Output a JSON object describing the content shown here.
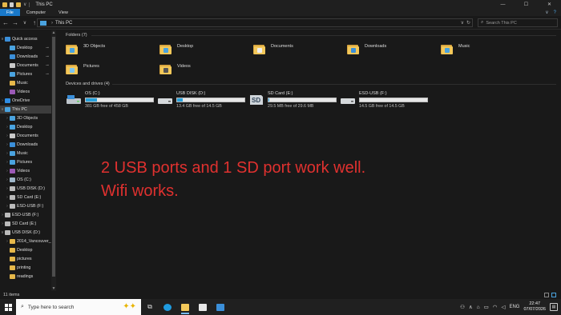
{
  "window": {
    "title": "This PC"
  },
  "ribbon": {
    "tabs": [
      {
        "label": "File",
        "active": true
      },
      {
        "label": "Computer"
      },
      {
        "label": "View"
      }
    ]
  },
  "address": {
    "crumbs": [
      "This PC"
    ]
  },
  "search": {
    "placeholder": "Search This PC"
  },
  "sidebar": {
    "items": [
      {
        "label": "Quick access",
        "level": 0,
        "expand": "v",
        "icon": "star-icon",
        "color": "#3b8fd9"
      },
      {
        "label": "Desktop",
        "level": 1,
        "icon": "desktop-icon",
        "color": "#4aa3df",
        "pinned": true
      },
      {
        "label": "Downloads",
        "level": 1,
        "icon": "download-icon",
        "color": "#3b8fd9",
        "pinned": true
      },
      {
        "label": "Documents",
        "level": 1,
        "icon": "documents-icon",
        "color": "#c9c9c9",
        "pinned": true
      },
      {
        "label": "Pictures",
        "level": 1,
        "icon": "pictures-icon",
        "color": "#4aa3df",
        "pinned": true
      },
      {
        "label": "Music",
        "level": 1,
        "icon": "folder-icon",
        "color": "#e6b84a"
      },
      {
        "label": "Videos",
        "level": 1,
        "icon": "videos-icon",
        "color": "#9b59b6"
      },
      {
        "label": "OneDrive",
        "level": 0,
        "expand": ">",
        "icon": "cloud-icon",
        "color": "#2f8de4"
      },
      {
        "label": "This PC",
        "level": 0,
        "expand": "v",
        "icon": "pc-icon",
        "color": "#4aa3df",
        "selected": true
      },
      {
        "label": "3D Objects",
        "level": 1,
        "expand": ">",
        "icon": "3d-icon",
        "color": "#4aa3df"
      },
      {
        "label": "Desktop",
        "level": 1,
        "expand": ">",
        "icon": "desktop-icon",
        "color": "#4aa3df"
      },
      {
        "label": "Documents",
        "level": 1,
        "expand": ">",
        "icon": "documents-icon",
        "color": "#c9c9c9"
      },
      {
        "label": "Downloads",
        "level": 1,
        "expand": ">",
        "icon": "download-icon",
        "color": "#3b8fd9"
      },
      {
        "label": "Music",
        "level": 1,
        "expand": ">",
        "icon": "music-icon",
        "color": "#4aa3df"
      },
      {
        "label": "Pictures",
        "level": 1,
        "expand": ">",
        "icon": "pictures-icon",
        "color": "#4aa3df"
      },
      {
        "label": "Videos",
        "level": 1,
        "expand": ">",
        "icon": "videos-icon",
        "color": "#9b59b6"
      },
      {
        "label": "OS (C:)",
        "level": 1,
        "expand": ">",
        "icon": "drive-icon",
        "color": "#9fb7c9"
      },
      {
        "label": "USB DISK (D:)",
        "level": 1,
        "expand": ">",
        "icon": "usb-drive-icon",
        "color": "#bbbbbb"
      },
      {
        "label": "SD Card (E:)",
        "level": 1,
        "expand": ">",
        "icon": "sd-card-icon",
        "color": "#bbbbbb"
      },
      {
        "label": "ESD-USB (F:)",
        "level": 1,
        "expand": ">",
        "icon": "usb-drive-icon",
        "color": "#bbbbbb"
      },
      {
        "label": "ESD-USB (F:)",
        "level": 0,
        "expand": ">",
        "icon": "usb-drive-icon",
        "color": "#bbbbbb"
      },
      {
        "label": "SD Card (E:)",
        "level": 0,
        "expand": ">",
        "icon": "sd-card-icon",
        "color": "#bbbbbb"
      },
      {
        "label": "USB DISK (D:)",
        "level": 0,
        "expand": "v",
        "icon": "usb-drive-icon",
        "color": "#bbbbbb"
      },
      {
        "label": "2014_Vancouver_",
        "level": 1,
        "expand": ">",
        "icon": "folder-icon",
        "color": "#e6b84a"
      },
      {
        "label": "Desktop",
        "level": 1,
        "icon": "folder-icon",
        "color": "#e6b84a"
      },
      {
        "label": "pictures",
        "level": 1,
        "icon": "folder-icon",
        "color": "#e6b84a"
      },
      {
        "label": "printing",
        "level": 1,
        "icon": "folder-icon",
        "color": "#e6b84a"
      },
      {
        "label": "readings",
        "level": 1,
        "icon": "folder-icon",
        "color": "#e6b84a"
      }
    ]
  },
  "folders": {
    "header": "Folders (7)",
    "items": [
      {
        "label": "3D Objects",
        "badge": "#4aa3df"
      },
      {
        "label": "Desktop",
        "badge": "#4aa3df"
      },
      {
        "label": "Documents",
        "badge": "#eeeeee"
      },
      {
        "label": "Downloads",
        "badge": "#3b8fd9"
      },
      {
        "label": "Music",
        "badge": "#4aa3df"
      },
      {
        "label": "Pictures",
        "badge": "#7fc6ef"
      },
      {
        "label": "Videos",
        "badge": "#555555"
      }
    ]
  },
  "drives": {
    "header": "Devices and drives (4)",
    "items": [
      {
        "name": "OS (C:)",
        "free": "381 GB free of 458 GB",
        "used_fraction": 0.17,
        "icon": "os-drive-icon"
      },
      {
        "name": "USB DISK (D:)",
        "free": "13.4 GB free of 14.5 GB",
        "used_fraction": 0.08,
        "icon": "usb-drive-icon"
      },
      {
        "name": "SD Card (E:)",
        "free": "29.5 MB free of 29.6 MB",
        "used_fraction": 0.01,
        "icon": "sd-card-icon"
      },
      {
        "name": "ESD-USB (F:)",
        "free": "14.5 GB free of 14.5 GB",
        "used_fraction": 0.0,
        "icon": "usb-drive-icon"
      }
    ]
  },
  "overlay": {
    "line1": "2 USB ports and 1 SD port work well.",
    "line2": "Wifi works."
  },
  "status": {
    "count": "11 items"
  },
  "taskbar": {
    "search_text": "Type here to search",
    "time": "22:47",
    "date": "07/07/2026",
    "language": "ENG"
  },
  "colors": {
    "accent": "#1979ca",
    "overlay_text": "#e0312f",
    "drive_bar": "#26a0da"
  }
}
